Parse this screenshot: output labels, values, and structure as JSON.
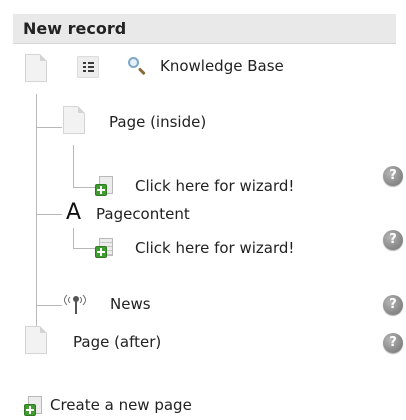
{
  "header": {
    "title": "New record"
  },
  "tree": {
    "root_label": "Knowledge Base",
    "page_inside": {
      "label": "Page (inside)",
      "wizard_label": "Click here for wizard!"
    },
    "pagecontent": {
      "icon_letter": "A",
      "label": "Pagecontent",
      "wizard_label": "Click here for wizard!"
    },
    "news": {
      "label": "News"
    },
    "page_after": {
      "label": "Page (after)"
    }
  },
  "help": {
    "glyph": "?"
  },
  "create_page": {
    "label": "Create a new page"
  },
  "icons": {
    "page": "page-icon",
    "list": "list-view-icon",
    "search": "magnifier-icon",
    "wizard": "new-page-plus-icon",
    "letter": "text-content-icon",
    "news": "antenna-icon",
    "help": "help-icon"
  },
  "colors": {
    "header_bg": "#e9e9e9",
    "plus_green": "#3f9c2f",
    "help_grey": "#7a7a7a"
  }
}
